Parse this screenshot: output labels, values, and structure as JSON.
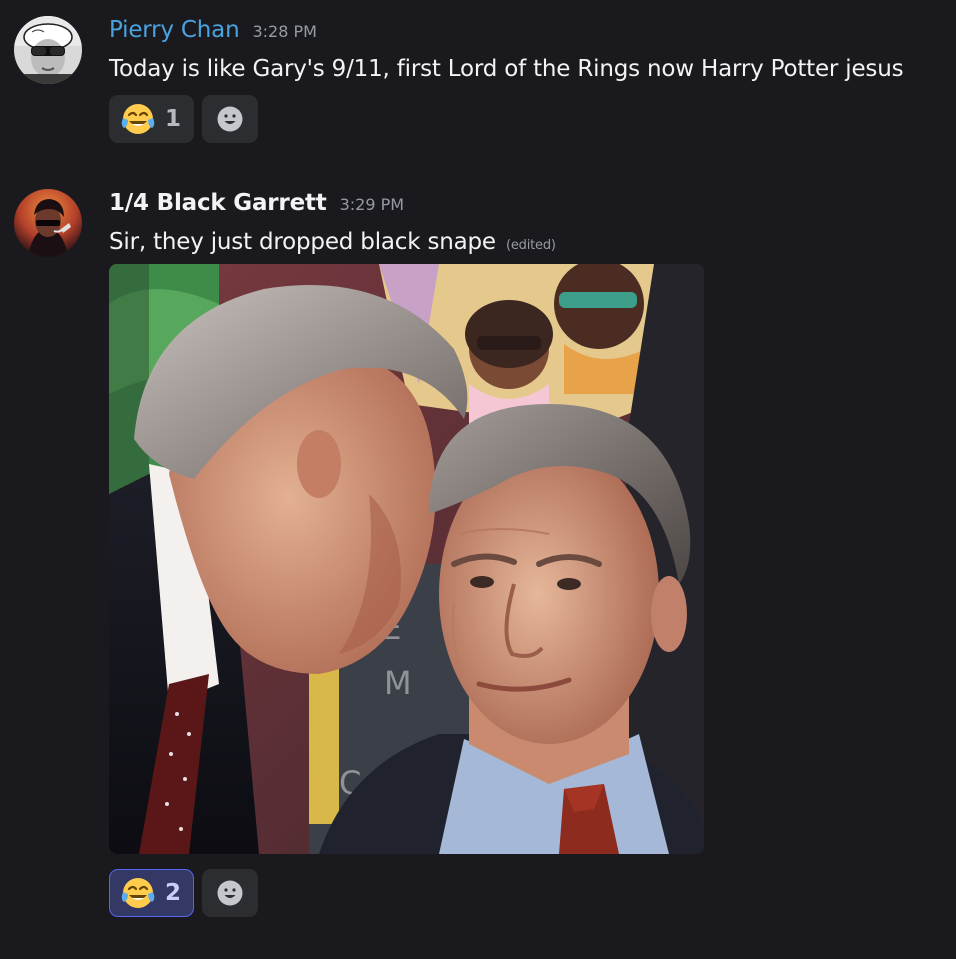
{
  "colors": {
    "background": "#1a1a1e",
    "username_1": "#4aa3e0",
    "username_2": "#f2f3f5",
    "reaction_active_border": "#5865f2"
  },
  "messages": [
    {
      "author": "Pierry Chan",
      "timestamp": "3:28 PM",
      "avatar": "avatar-sunglasses-cap",
      "text": "Today is like Gary's 9/11, first Lord of the Rings now Harry Potter jesus",
      "reactions": [
        {
          "emoji": "joy-emoji",
          "count": "1",
          "active": false
        }
      ],
      "add_reaction_icon": "smiley-add-icon"
    },
    {
      "author": "1/4 Black Garrett",
      "timestamp": "3:29 PM",
      "avatar": "avatar-dark-portrait",
      "text": "Sir, they just dropped black snape",
      "edited_label": "(edited)",
      "attachment": "image-photo-meme",
      "reactions": [
        {
          "emoji": "joy-emoji",
          "count": "2",
          "active": true
        }
      ],
      "add_reaction_icon": "smiley-add-icon"
    }
  ]
}
